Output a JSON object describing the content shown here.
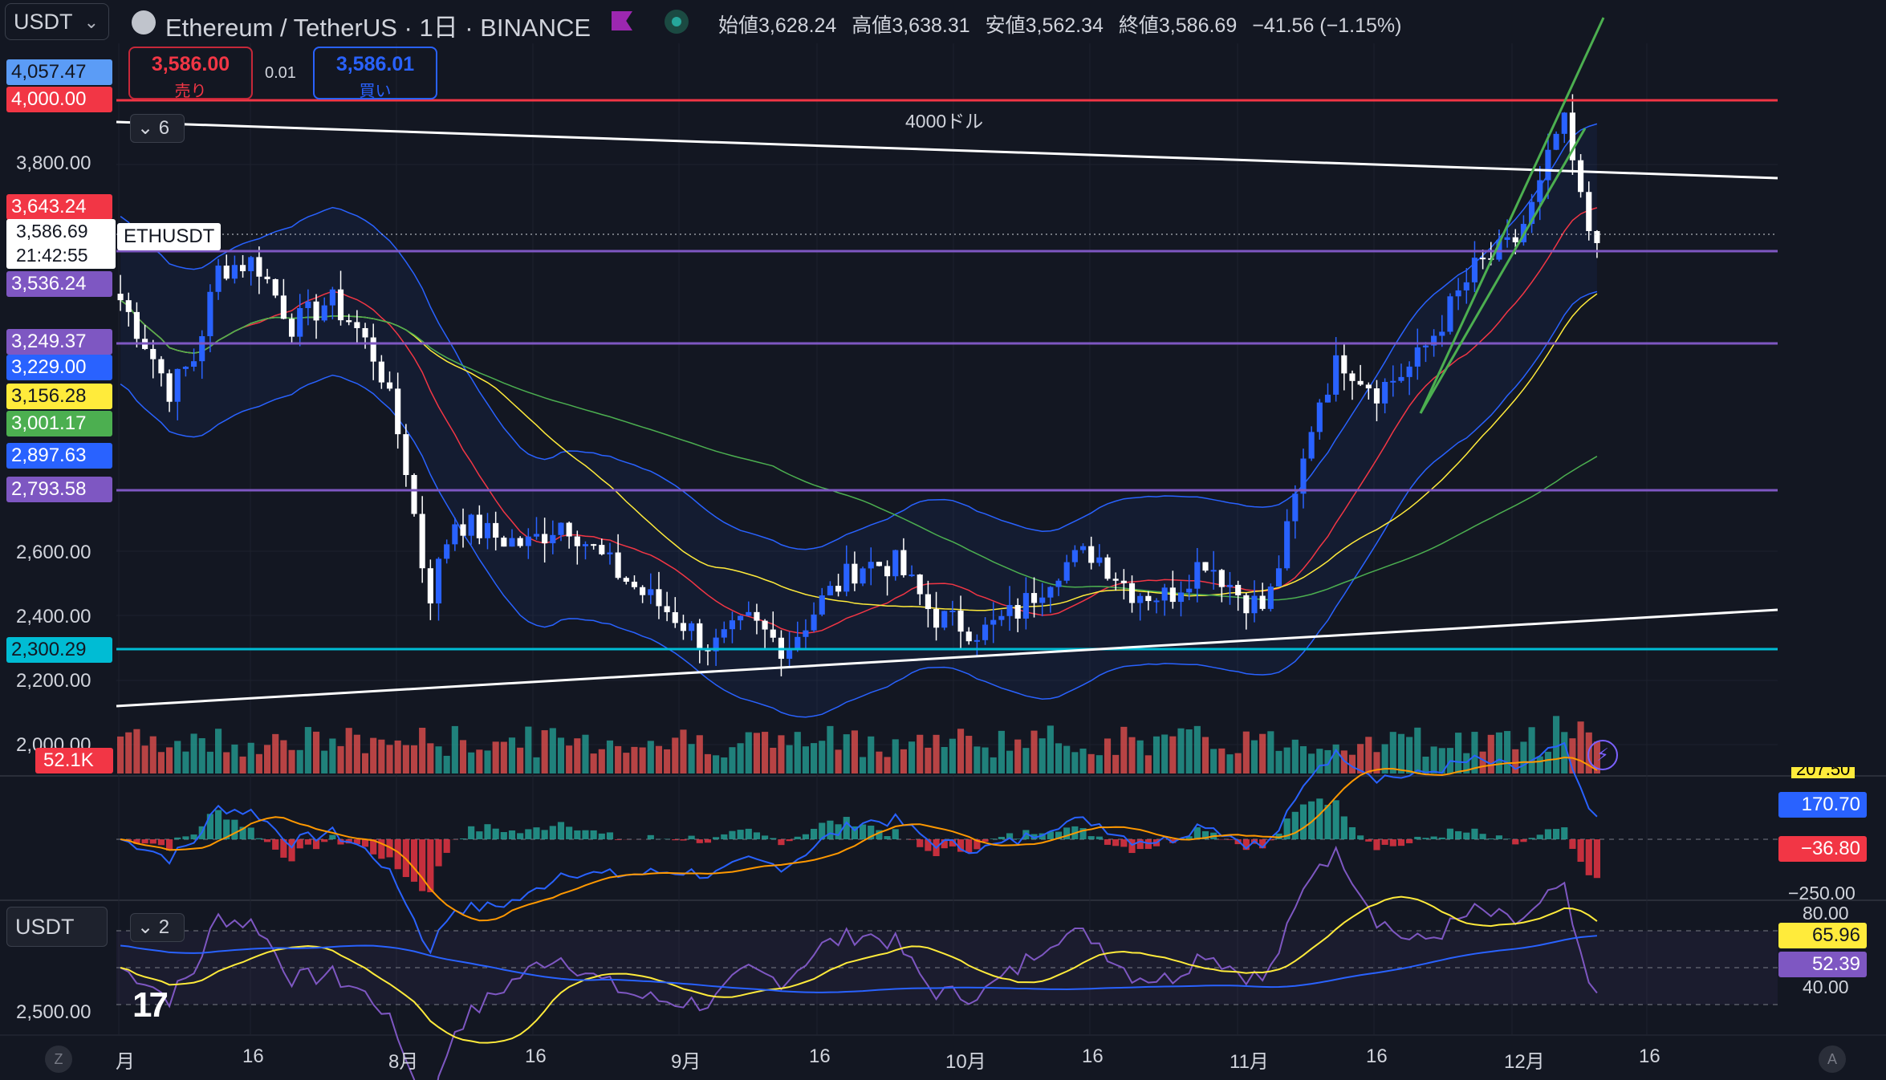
{
  "header": {
    "symbol_select": "USDT",
    "title": "Ethereum / TetherUS · 1日 · BINANCE",
    "ohlc": {
      "open_label": "始値",
      "open": "3,628.24",
      "high_label": "高値",
      "high": "3,638.31",
      "low_label": "安値",
      "low": "3,562.34",
      "close_label": "終値",
      "close": "3,586.69",
      "change": "−41.56 (−1.15%)"
    }
  },
  "trade": {
    "sell_price": "3,586.00",
    "sell_label": "売り",
    "spread": "0.01",
    "buy_price": "3,586.01",
    "buy_label": "買い"
  },
  "indicator_toggle_main": "6",
  "indicator_toggle_rsi": "2",
  "annotation_4000": "4000ドル",
  "symbol_tag": "ETHUSDT",
  "current_price": {
    "price": "3,586.69",
    "countdown": "21:42:55"
  },
  "volume_tag": "52.1K",
  "rsi_select": "USDT",
  "price_axis": {
    "labels": [
      "3,800.00",
      "2,600.00",
      "2,400.00",
      "2,200.00",
      "2,000.00",
      "2,500.00"
    ],
    "tags": [
      {
        "value": "4,057.47",
        "bg": "#5b9cf6",
        "fg": "#131722"
      },
      {
        "value": "4,000.00",
        "bg": "#f23645",
        "fg": "#ffffff"
      },
      {
        "value": "3,643.24",
        "bg": "#f23645",
        "fg": "#ffffff"
      },
      {
        "value": "3,536.24",
        "bg": "#7e57c2",
        "fg": "#ffffff"
      },
      {
        "value": "3,249.37",
        "bg": "#7e57c2",
        "fg": "#ffffff"
      },
      {
        "value": "3,229.00",
        "bg": "#2962ff",
        "fg": "#ffffff"
      },
      {
        "value": "3,156.28",
        "bg": "#ffeb3b",
        "fg": "#131722"
      },
      {
        "value": "3,001.17",
        "bg": "#4caf50",
        "fg": "#ffffff"
      },
      {
        "value": "2,897.63",
        "bg": "#2962ff",
        "fg": "#ffffff"
      },
      {
        "value": "2,793.58",
        "bg": "#7e57c2",
        "fg": "#ffffff"
      },
      {
        "value": "2,300.29",
        "bg": "#00bcd4",
        "fg": "#131722"
      }
    ]
  },
  "macd_axis": {
    "tags": [
      {
        "value": "170.70",
        "bg": "#2962ff",
        "fg": "#ffffff"
      },
      {
        "value": "−36.80",
        "bg": "#f23645",
        "fg": "#ffffff"
      }
    ],
    "labels": [
      "−250.00"
    ],
    "partial_top": "207.50"
  },
  "rsi_axis": {
    "labels": [
      "80.00",
      "40.00"
    ],
    "tags": [
      {
        "value": "65.96",
        "bg": "#ffeb3b",
        "fg": "#131722"
      },
      {
        "value": "52.39",
        "bg": "#7e57c2",
        "fg": "#ffffff"
      }
    ]
  },
  "time_axis": [
    "月",
    "16",
    "8月",
    "16",
    "9月",
    "16",
    "10月",
    "16",
    "11月",
    "16",
    "12月",
    "16"
  ],
  "icons": {
    "z": "Z",
    "a": "A",
    "logo": "17",
    "bolt": "⚡"
  },
  "colors": {
    "up": "#2962ff",
    "down": "#ffffff",
    "vol_up": "#26a69a",
    "vol_down": "#ef5350",
    "resistance": "#f23645",
    "support": "#7e57c2",
    "trend": "#ffffff",
    "channel": "#4caf50"
  }
}
